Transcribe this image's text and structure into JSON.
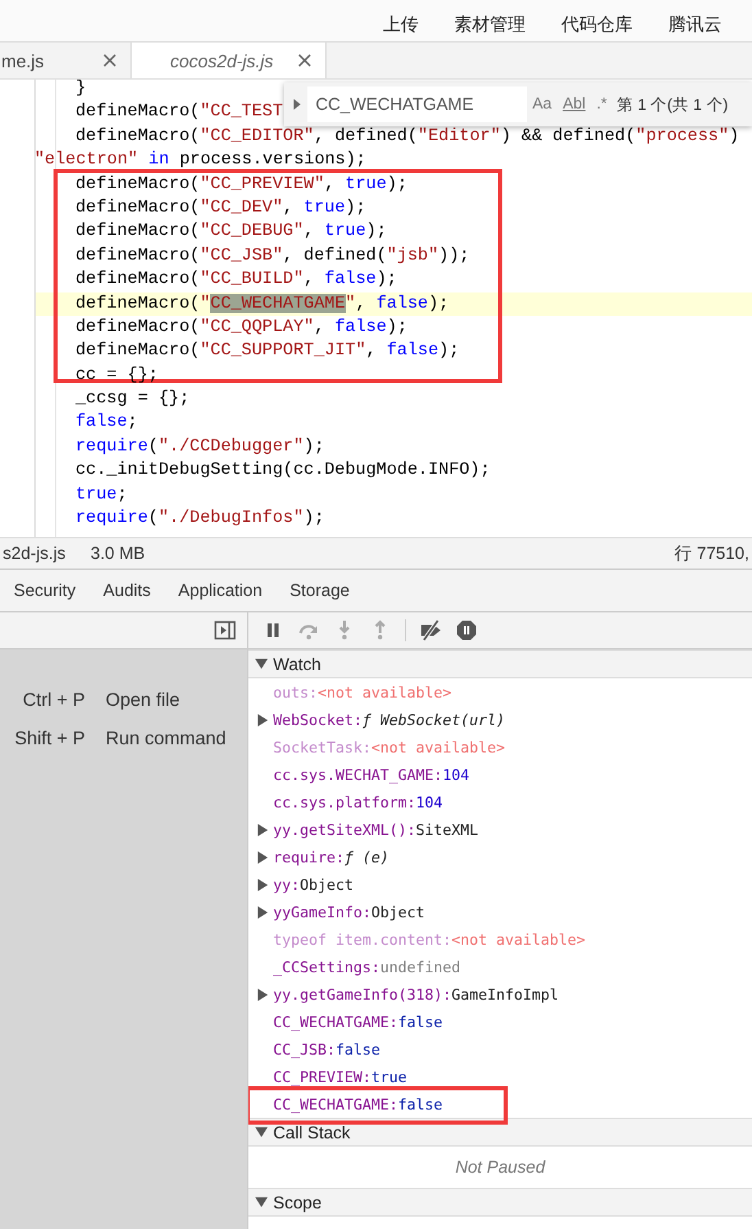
{
  "top_menu": [
    {
      "label": "上传"
    },
    {
      "label": "素材管理"
    },
    {
      "label": "代码仓库"
    },
    {
      "label": "腾讯云"
    }
  ],
  "editor_tabs": [
    {
      "label": "me.js",
      "selected": false
    },
    {
      "label": "cocos2d-js.js",
      "selected": true
    }
  ],
  "code_lines": [
    {
      "kind": "code",
      "highlighted": false,
      "tokens": [
        {
          "kind": "plain",
          "text": "}"
        }
      ]
    },
    {
      "kind": "code",
      "highlighted": false,
      "tokens": [
        {
          "kind": "plain",
          "text": "defineMacro("
        },
        {
          "kind": "string",
          "text": "\"CC_TEST"
        }
      ]
    },
    {
      "kind": "code",
      "highlighted": false,
      "tokens": [
        {
          "kind": "plain",
          "text": "defineMacro("
        },
        {
          "kind": "string",
          "text": "\"CC_EDITOR\""
        },
        {
          "kind": "plain",
          "text": ", defined("
        },
        {
          "kind": "string",
          "text": "\"Editor\""
        },
        {
          "kind": "plain",
          "text": ") && defined("
        },
        {
          "kind": "string",
          "text": "\"process\""
        },
        {
          "kind": "plain",
          "text": ")"
        }
      ]
    },
    {
      "kind": "wrapped",
      "highlighted": false,
      "tokens": [
        {
          "kind": "string",
          "text": "\"electron\""
        },
        {
          "kind": "keyword",
          "text": " in"
        },
        {
          "kind": "plain",
          "text": " process.versions);"
        }
      ]
    },
    {
      "kind": "annotated_group",
      "lines": [
        {
          "kind": "code",
          "highlighted": false,
          "tokens": [
            {
              "kind": "plain",
              "text": "defineMacro("
            },
            {
              "kind": "string",
              "text": "\"CC_PREVIEW\""
            },
            {
              "kind": "plain",
              "text": ", "
            },
            {
              "kind": "keyword",
              "text": "true"
            },
            {
              "kind": "plain",
              "text": ");"
            }
          ]
        },
        {
          "kind": "code",
          "highlighted": false,
          "tokens": [
            {
              "kind": "plain",
              "text": "defineMacro("
            },
            {
              "kind": "string",
              "text": "\"CC_DEV\""
            },
            {
              "kind": "plain",
              "text": ", "
            },
            {
              "kind": "keyword",
              "text": "true"
            },
            {
              "kind": "plain",
              "text": ");"
            }
          ]
        },
        {
          "kind": "code",
          "highlighted": false,
          "tokens": [
            {
              "kind": "plain",
              "text": "defineMacro("
            },
            {
              "kind": "string",
              "text": "\"CC_DEBUG\""
            },
            {
              "kind": "plain",
              "text": ", "
            },
            {
              "kind": "keyword",
              "text": "true"
            },
            {
              "kind": "plain",
              "text": ");"
            }
          ]
        },
        {
          "kind": "code",
          "highlighted": false,
          "tokens": [
            {
              "kind": "plain",
              "text": "defineMacro("
            },
            {
              "kind": "string",
              "text": "\"CC_JSB\""
            },
            {
              "kind": "plain",
              "text": ", defined("
            },
            {
              "kind": "string",
              "text": "\"jsb\""
            },
            {
              "kind": "plain",
              "text": "));"
            }
          ]
        },
        {
          "kind": "code",
          "highlighted": false,
          "tokens": [
            {
              "kind": "plain",
              "text": "defineMacro("
            },
            {
              "kind": "string",
              "text": "\"CC_BUILD\""
            },
            {
              "kind": "plain",
              "text": ", "
            },
            {
              "kind": "keyword",
              "text": "false"
            },
            {
              "kind": "plain",
              "text": ");"
            }
          ]
        },
        {
          "kind": "code",
          "highlighted": true,
          "tokens": [
            {
              "kind": "plain",
              "text": "defineMacro("
            },
            {
              "kind": "string",
              "text": "\""
            },
            {
              "kind": "match",
              "text": "CC_WECHATGAME"
            },
            {
              "kind": "string",
              "text": "\""
            },
            {
              "kind": "plain",
              "text": ", "
            },
            {
              "kind": "keyword",
              "text": "false"
            },
            {
              "kind": "plain",
              "text": ");"
            }
          ]
        },
        {
          "kind": "code",
          "highlighted": false,
          "tokens": [
            {
              "kind": "plain",
              "text": "defineMacro("
            },
            {
              "kind": "string",
              "text": "\"CC_QQPLAY\""
            },
            {
              "kind": "plain",
              "text": ", "
            },
            {
              "kind": "keyword",
              "text": "false"
            },
            {
              "kind": "plain",
              "text": ");"
            }
          ]
        },
        {
          "kind": "code",
          "highlighted": false,
          "tokens": [
            {
              "kind": "plain",
              "text": "defineMacro("
            },
            {
              "kind": "string",
              "text": "\"CC_SUPPORT_JIT\""
            },
            {
              "kind": "plain",
              "text": ", "
            },
            {
              "kind": "keyword",
              "text": "false"
            },
            {
              "kind": "plain",
              "text": ");"
            }
          ]
        }
      ]
    },
    {
      "kind": "code",
      "highlighted": false,
      "tokens": [
        {
          "kind": "plain",
          "text": "cc = {};"
        }
      ]
    },
    {
      "kind": "code",
      "highlighted": false,
      "tokens": [
        {
          "kind": "plain",
          "text": "_ccsg = {};"
        }
      ]
    },
    {
      "kind": "code",
      "highlighted": false,
      "tokens": [
        {
          "kind": "keyword",
          "text": "false"
        },
        {
          "kind": "plain",
          "text": ";"
        }
      ]
    },
    {
      "kind": "code",
      "highlighted": false,
      "tokens": [
        {
          "kind": "keyword",
          "text": "require"
        },
        {
          "kind": "plain",
          "text": "("
        },
        {
          "kind": "string",
          "text": "\"./CCDebugger\""
        },
        {
          "kind": "plain",
          "text": ");"
        }
      ]
    },
    {
      "kind": "code",
      "highlighted": false,
      "tokens": [
        {
          "kind": "plain",
          "text": "cc._initDebugSetting(cc.DebugMode.INFO);"
        }
      ]
    },
    {
      "kind": "code",
      "highlighted": false,
      "tokens": [
        {
          "kind": "keyword",
          "text": "true"
        },
        {
          "kind": "plain",
          "text": ";"
        }
      ]
    },
    {
      "kind": "code",
      "highlighted": false,
      "tokens": [
        {
          "kind": "keyword",
          "text": "require"
        },
        {
          "kind": "plain",
          "text": "("
        },
        {
          "kind": "string",
          "text": "\"./DebugInfos\""
        },
        {
          "kind": "plain",
          "text": ");"
        }
      ]
    }
  ],
  "find_widget": {
    "value": "CC_WECHATGAME",
    "options": [
      {
        "label": "Aa",
        "selected": false
      },
      {
        "label": "Abl",
        "selected": false
      },
      {
        "label": ".*",
        "selected": false
      }
    ],
    "result": "第 1 个(共 1 个)"
  },
  "status_bar": {
    "file": "s2d-js.js",
    "size": "3.0 MB",
    "position": "行 77510,"
  },
  "devtools_tabs": [
    {
      "label": "Security",
      "selected": false
    },
    {
      "label": "Audits",
      "selected": false
    },
    {
      "label": "Application",
      "selected": false
    },
    {
      "label": "Storage",
      "selected": false
    }
  ],
  "shortcuts": [
    {
      "keys": "Ctrl + P",
      "action": "Open file"
    },
    {
      "keys": "Shift + P",
      "action": "Run command"
    }
  ],
  "watch": {
    "title": "Watch",
    "expanded": true,
    "items": [
      {
        "kind": "unavailable",
        "name": "outs:",
        "value": "<not available>",
        "expandable": false,
        "available": false
      },
      {
        "kind": "function",
        "name": "WebSocket:",
        "value": "ƒ WebSocket(url)",
        "expandable": true,
        "available": true
      },
      {
        "kind": "unavailable",
        "name": "SocketTask:",
        "value": "<not available>",
        "expandable": false,
        "available": false
      },
      {
        "kind": "number",
        "name": "cc.sys.WECHAT_GAME:",
        "value": "104",
        "expandable": false,
        "available": true
      },
      {
        "kind": "number",
        "name": "cc.sys.platform:",
        "value": "104",
        "expandable": false,
        "available": true
      },
      {
        "kind": "object",
        "name": "yy.getSiteXML():",
        "value": "SiteXML",
        "expandable": true,
        "available": true
      },
      {
        "kind": "function",
        "name": "require:",
        "value": "ƒ (e)",
        "expandable": true,
        "available": true
      },
      {
        "kind": "object",
        "name": "yy:",
        "value": "Object",
        "expandable": true,
        "available": true
      },
      {
        "kind": "object",
        "name": "yyGameInfo:",
        "value": "Object",
        "expandable": true,
        "available": true
      },
      {
        "kind": "unavailable",
        "name": "typeof item.content:",
        "value": "<not available>",
        "expandable": false,
        "available": false
      },
      {
        "kind": "undefined",
        "name": "_CCSettings:",
        "value": "undefined",
        "expandable": false,
        "available": true
      },
      {
        "kind": "object",
        "name": "yy.getGameInfo(318):",
        "value": "GameInfoImpl",
        "expandable": true,
        "available": true
      },
      {
        "kind": "boolean",
        "name": "CC_WECHATGAME:",
        "value": "false",
        "expandable": false,
        "available": true
      },
      {
        "kind": "boolean",
        "name": "CC_JSB:",
        "value": "false",
        "expandable": false,
        "available": true
      },
      {
        "kind": "boolean",
        "name": "CC_PREVIEW:",
        "value": "true",
        "expandable": false,
        "available": true
      },
      {
        "kind": "annotated_group",
        "items": [
          {
            "kind": "boolean",
            "name": "CC_WECHATGAME:",
            "value": "false",
            "expandable": false,
            "available": true
          }
        ]
      }
    ]
  },
  "call_stack": {
    "title": "Call Stack",
    "expanded": true,
    "message": "Not Paused"
  },
  "scope": {
    "title": "Scope",
    "expanded": true
  }
}
